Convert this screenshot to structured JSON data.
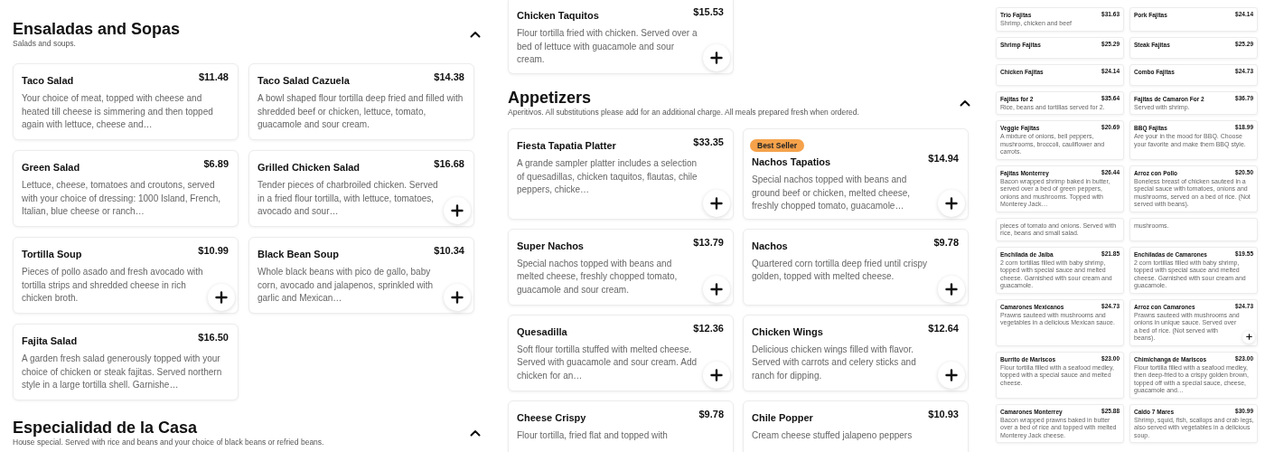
{
  "panels": [
    {
      "sections": [
        {
          "title": "Ensaladas and Sopas",
          "subtitle": "Salads and soups.",
          "expanded": true,
          "items": [
            {
              "name": "Taco Salad",
              "price": "$11.48",
              "description": "Your choice of meat, topped with cheese and heated till cheese is simmering and then topped again with lettuce, cheese and…",
              "add_button": false
            },
            {
              "name": "Taco Salad Cazuela",
              "price": "$14.38",
              "description": "A bowl shaped flour tortilla deep fried and filled with shredded beef or chicken, lettuce, tomato, guacamole and sour cream.",
              "add_button": false
            },
            {
              "name": "Green Salad",
              "price": "$6.89",
              "description": "Lettuce, cheese, tomatoes and croutons, served with your choice of dressing: 1000 Island, French, Italian, blue cheese or ranch…",
              "add_button": false
            },
            {
              "name": "Grilled Chicken Salad",
              "price": "$16.68",
              "description": "Tender pieces of charbroiled chicken. Served in a fried flour tortilla, with lettuce, tomatoes, avocado and sour…",
              "add_button": true
            },
            {
              "name": "Tortilla Soup",
              "price": "$10.99",
              "description": "Pieces of pollo asado and fresh avocado with tortilla strips and shredded cheese in rich chicken broth.",
              "add_button": true
            },
            {
              "name": "Black Bean Soup",
              "price": "$10.34",
              "description": "Whole black beans with pico de gallo, baby corn, avocado and jalapenos, sprinkled with garlic and Mexican…",
              "add_button": true
            },
            {
              "name": "Fajita Salad",
              "price": "$16.50",
              "description": "A garden fresh salad generously topped with your choice of chicken or steak fajitas. Served northern style in a large tortilla shell. Garnishe…",
              "add_button": false
            }
          ]
        },
        {
          "title": "Especialidad de la Casa",
          "subtitle": "House special. Served with rice and beans and your choice of black beans or refried beans.",
          "expanded": true
        }
      ]
    },
    {
      "sections": [
        {
          "items": [
            {
              "name": "Chicken Taquitos",
              "price": "$15.53",
              "description": "Flour tortilla fried with chicken. Served over a bed of lettuce with guacamole and sour cream.",
              "add_button": true
            }
          ]
        },
        {
          "title": "Appetizers",
          "subtitle": "Aperitivos. All substitutions please add for an additional charge. All meals prepared fresh when ordered.",
          "expanded": true,
          "items": [
            {
              "name": "Fiesta Tapatia Platter",
              "price": "$33.35",
              "description": "A grande sampler platter includes a selection of quesadillas, chicken taquitos, flautas, chile peppers, chicke…",
              "add_button": true
            },
            {
              "name": "Nachos Tapatios",
              "price": "$14.94",
              "badge": "Best Seller",
              "description": "Special nachos topped with beans and ground beef or chicken, melted cheese, freshly chopped tomato, guacamole…",
              "add_button": true
            },
            {
              "name": "Super Nachos",
              "price": "$13.79",
              "description": "Special nachos topped with beans and melted cheese, freshly chopped tomato, guacamole and sour cream.",
              "add_button": true
            },
            {
              "name": "Nachos",
              "price": "$9.78",
              "description": "Quartered corn tortilla deep fried until crispy golden, topped with melted cheese.",
              "add_button": true
            },
            {
              "name": "Quesadilla",
              "price": "$12.36",
              "description": "Soft flour tortilla stuffed with melted cheese. Served with guacamole and sour cream. Add chicken for an…",
              "add_button": true
            },
            {
              "name": "Chicken Wings",
              "price": "$12.64",
              "description": "Delicious chicken wings filled with flavor. Served with carrots and celery sticks and ranch for dipping.",
              "add_button": true
            },
            {
              "name": "Cheese Crispy",
              "price": "$9.78",
              "description": "Flour tortilla, fried flat and topped with",
              "add_button": false
            },
            {
              "name": "Chile Popper",
              "price": "$10.93",
              "description": "Cream cheese stuffed jalapeno peppers",
              "add_button": false
            }
          ]
        }
      ]
    },
    {
      "sections": [
        {
          "items": [
            {
              "name": "Trio Fajitas",
              "price": "$31.63",
              "description": "Shrimp, chicken and beef",
              "add_button": false
            },
            {
              "name": "Pork Fajitas",
              "price": "$24.14",
              "add_button": false
            },
            {
              "name": "Shrimp Fajitas",
              "price": "$25.29",
              "add_button": false
            },
            {
              "name": "Steak Fajitas",
              "price": "$25.29",
              "add_button": false
            },
            {
              "name": "Chicken Fajitas",
              "price": "$24.14",
              "add_button": false
            },
            {
              "name": "Combo Fajitas",
              "price": "$24.73",
              "add_button": false
            },
            {
              "name": "Fajitas for 2",
              "price": "$35.64",
              "description": "Rice, beans and tortillas served for 2.",
              "add_button": false
            },
            {
              "name": "Fajitas de Camaron For 2",
              "price": "$36.79",
              "description": "Served with shrimp.",
              "add_button": false
            },
            {
              "name": "Veggie Fajitas",
              "price": "$20.69",
              "description": "A mixture of onions, bell peppers, mushrooms, broccoli, cauliflower and carrots.",
              "add_button": false
            },
            {
              "name": "BBQ Fajitas",
              "price": "$18.99",
              "description": "Are your in the mood for BBQ. Choose your favorite and make them BBQ style.",
              "add_button": false
            },
            {
              "name": "Fajitas Monterrey",
              "price": "$26.44",
              "description": "Bacon wrapped shrimp baked in butter, served over a bed of green peppers, onions and mushrooms. Topped with Monterey Jack…",
              "add_button": false
            },
            {
              "name": "Arroz con Pollo",
              "price": "$20.50",
              "description": "Boneless breast of chicken sauteed in a special sauce with tomatoes, onions and mushrooms, served on a bed of rice. (Not served with beans).",
              "add_button": false
            },
            {
              "description": "pieces of tomato and onions. Served with rice, beans and small salad.",
              "add_button": false
            },
            {
              "description": "mushrooms.",
              "add_button": false
            },
            {
              "name": "Enchilada de Jaiba",
              "price": "$21.85",
              "description": "2 corn tortillas filled with baby shrimp, topped with special sauce and melted cheese. Garnished with sour cream and guacamole.",
              "add_button": false
            },
            {
              "name": "Enchiladas de Camarones",
              "price": "$19.55",
              "description": "2 corn tortillas filled with baby shrimp, topped with special sauce and melted cheese. Garnished with sour cream and guacamole.",
              "add_button": false
            },
            {
              "name": "Camarones Mexicanos",
              "price": "$24.73",
              "description": "Prawns sauteed with mushrooms and vegetables in a delicious Mexican sauce.",
              "add_button": false
            },
            {
              "name": "Arroz con Camarones",
              "price": "$24.73",
              "description": "Prawns sauteed with mushrooms and onions in unique sauce. Served over a bed of rice. (Not served with beans).",
              "add_button": true
            },
            {
              "name": "Burrito de Mariscos",
              "price": "$23.00",
              "description": "Flour tortilla filled with a seafood medley, topped with a special sauce and melted cheese.",
              "add_button": false
            },
            {
              "name": "Chimichanga de Mariscos",
              "price": "$23.00",
              "description": "Flour tortilla filled with a seafood medley, then deep-fried to a crispy golden brown, topped off with a special sauce, cheese, guacamole and…",
              "add_button": false
            },
            {
              "name": "Camarones Monterrey",
              "price": "$25.88",
              "description": "Bacon wrapped prawns baked in butter over a bed of rice and topped with melted Monterey Jack cheese.",
              "add_button": false
            },
            {
              "name": "Caldo 7 Mares",
              "price": "$30.99",
              "description": "Shrimp, squid, fish, scallops and crab legs, also served with vegetables in a delicious soup.",
              "add_button": false
            }
          ]
        }
      ]
    }
  ]
}
